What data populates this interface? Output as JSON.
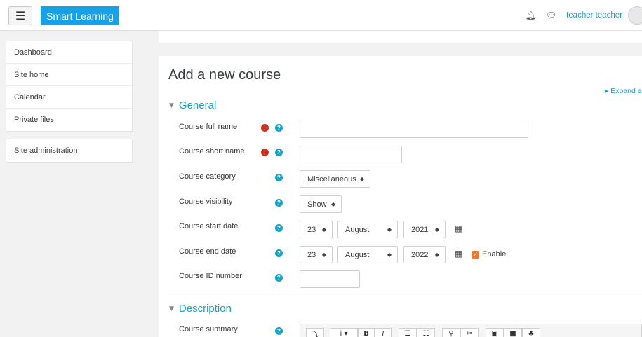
{
  "navbar": {
    "brand": "Smart Learning",
    "username": "teacher teacher",
    "icons": [
      "hamburger-icon",
      "bell-icon",
      "chat-icon",
      "avatar"
    ]
  },
  "drawer": {
    "nav": [
      "Dashboard",
      "Site home",
      "Calendar",
      "Private files"
    ],
    "admin": "Site administration"
  },
  "main": {
    "title": "Add a new course",
    "expand_all": "▸ Expand a",
    "sections": {
      "general": "General",
      "description": "Description"
    },
    "fields": {
      "full_name": {
        "label": "Course full name",
        "value": ""
      },
      "short_name": {
        "label": "Course short name",
        "value": ""
      },
      "category": {
        "label": "Course category",
        "value": "Miscellaneous"
      },
      "visibility": {
        "label": "Course visibility",
        "value": "Show"
      },
      "start_date": {
        "label": "Course start date",
        "day": "23",
        "month": "August",
        "year": "2021"
      },
      "end_date": {
        "label": "Course end date",
        "day": "23",
        "month": "August",
        "year": "2022",
        "enable_label": "Enable"
      },
      "id_number": {
        "label": "Course ID number",
        "value": ""
      },
      "summary": {
        "label": "Course summary"
      }
    }
  },
  "colors": {
    "brand": "#17a2e8",
    "link": "#17a2c8",
    "required": "#ca3120",
    "checkbox": "#e8773a"
  }
}
